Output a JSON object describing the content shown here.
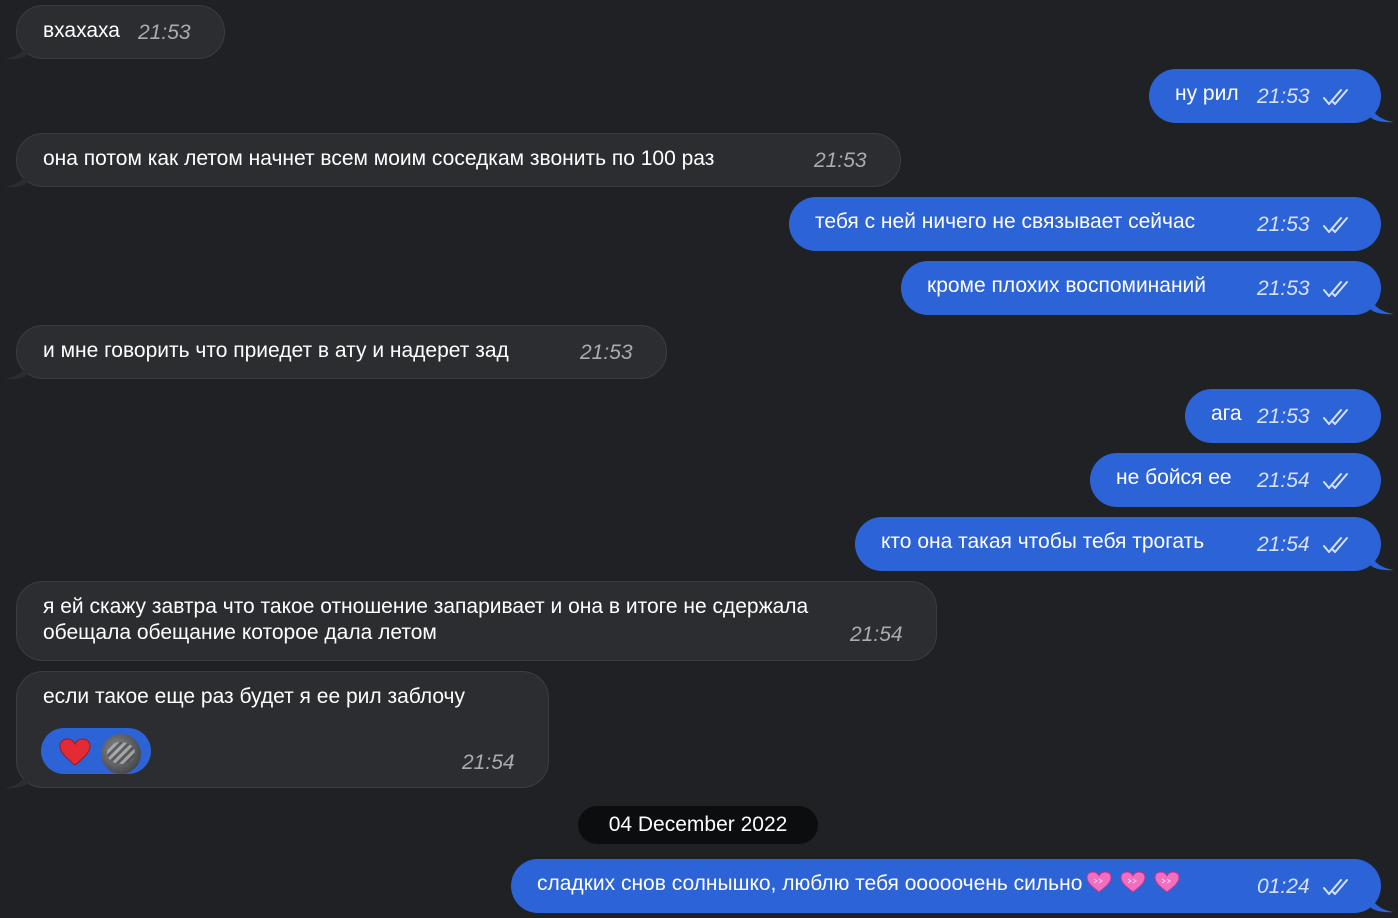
{
  "messages": [
    {
      "dir": "in",
      "text": "вхахаха",
      "time": "21:53"
    },
    {
      "dir": "out",
      "text": "ну рил",
      "time": "21:53"
    },
    {
      "dir": "in",
      "text": "она потом как летом начнет всем моим соседкам звонить по 100 раз",
      "time": "21:53"
    },
    {
      "dir": "out",
      "text": "тебя с ней ничего не связывает сейчас",
      "time": "21:53"
    },
    {
      "dir": "out",
      "text": "кроме плохих воспоминаний",
      "time": "21:53"
    },
    {
      "dir": "in",
      "text": "и мне говорить что приедет в ату и надерет зад",
      "time": "21:53"
    },
    {
      "dir": "out",
      "text": "ага",
      "time": "21:53"
    },
    {
      "dir": "out",
      "text": "не бойся ее",
      "time": "21:54"
    },
    {
      "dir": "out",
      "text": "кто она такая чтобы тебя трогать",
      "time": "21:54"
    },
    {
      "dir": "in",
      "line1": "я ей скажу завтра что такое отношение запаривает и она в итоге не сдержала",
      "line2": "обещала обещание которое дала летом",
      "time": "21:54"
    },
    {
      "dir": "in",
      "text": "если такое еще раз будет я ее рил заблочу",
      "time": "21:54",
      "reaction": "heart-icon"
    },
    {
      "dir": "out",
      "text": "сладких снов солнышко, люблю тебя ооооочень сильно",
      "time": "01:24",
      "emoji": [
        "pink-heart-icon",
        "pink-heart-icon",
        "pink-heart-icon"
      ]
    }
  ],
  "date_separator": "04 December 2022",
  "colors": {
    "background": "#1f2125",
    "incoming_bubble": "#2c2d30",
    "outgoing_bubble": "#2c63d6",
    "date_pill": "#0c0d0f"
  }
}
